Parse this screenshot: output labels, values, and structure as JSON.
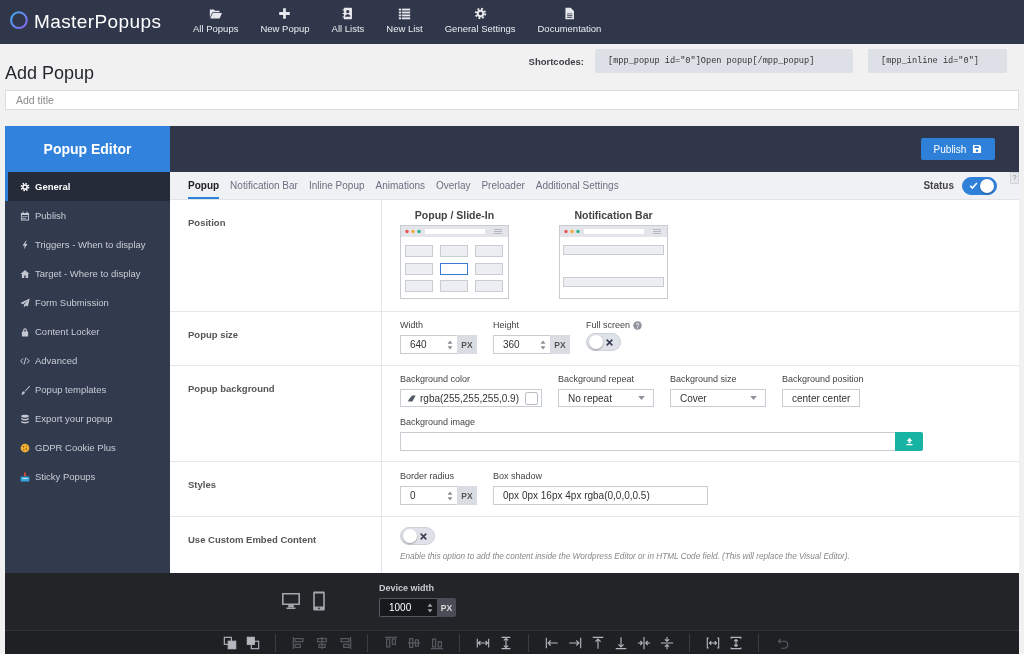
{
  "top_bar": {
    "logo": "MasterPopups",
    "nav": [
      {
        "label": "All Popups"
      },
      {
        "label": "New Popup"
      },
      {
        "label": "All Lists"
      },
      {
        "label": "New List"
      },
      {
        "label": "General Settings"
      },
      {
        "label": "Documentation"
      }
    ]
  },
  "page": {
    "title": "Add Popup",
    "shortcodes": {
      "label": "Shortcodes:",
      "codes": [
        "[mpp_popup id=\"0\"]Open popup[/mpp_popup]",
        "[mpp_inline id=\"0\"]"
      ]
    },
    "title_field": {
      "placeholder": "Add title"
    }
  },
  "editor": {
    "title": "Popup Editor",
    "publish_button": "Publish",
    "sidebar": [
      {
        "label": "General",
        "selected": true
      },
      {
        "label": "Publish",
        "selected": false
      },
      {
        "label": "Triggers - When to display",
        "selected": false
      },
      {
        "label": "Target - Where to display",
        "selected": false
      },
      {
        "label": "Form Submission",
        "selected": false
      },
      {
        "label": "Content Locker",
        "selected": false
      },
      {
        "label": "Advanced",
        "selected": false
      },
      {
        "label": "Popup templates",
        "selected": false
      },
      {
        "label": "Export your popup",
        "selected": false
      },
      {
        "label": "GDPR Cookie Plus",
        "selected": false
      },
      {
        "label": "Sticky Popups",
        "selected": false
      }
    ],
    "tabs": [
      {
        "label": "Popup",
        "selected": true
      },
      {
        "label": "Notification Bar",
        "selected": false
      },
      {
        "label": "Inline Popup",
        "selected": false
      },
      {
        "label": "Animations",
        "selected": false
      },
      {
        "label": "Overlay",
        "selected": false
      },
      {
        "label": "Preloader",
        "selected": false
      },
      {
        "label": "Additional Settings",
        "selected": false
      }
    ],
    "status": {
      "label": "Status",
      "on": true
    },
    "help_tab": "?",
    "sections": [
      {
        "kind": "position",
        "label": "Position",
        "options": [
          {
            "title": "Popup / Slide-In",
            "kind": "grid",
            "cells": [
              {
                "selected": false
              },
              {
                "selected": false
              },
              {
                "selected": false
              },
              {
                "selected": false
              },
              {
                "selected": true
              },
              {
                "selected": false
              },
              {
                "selected": false
              },
              {
                "selected": false
              },
              {
                "selected": false
              }
            ]
          },
          {
            "title": "Notification Bar",
            "kind": "bars",
            "cells": [
              {
                "selected": false
              },
              {
                "selected": false
              }
            ]
          }
        ]
      },
      {
        "kind": "size",
        "label": "Popup size",
        "width": {
          "label": "Width",
          "value": "640",
          "unit": "PX"
        },
        "height": {
          "label": "Height",
          "value": "360",
          "unit": "PX"
        },
        "full_screen": {
          "label": "Full screen",
          "on": false
        }
      },
      {
        "kind": "background",
        "label": "Popup background",
        "color": {
          "label": "Background color",
          "value": "rgba(255,255,255,0.9)"
        },
        "repeat": {
          "label": "Background repeat",
          "value": "No repeat"
        },
        "size": {
          "label": "Background size",
          "value": "Cover"
        },
        "position": {
          "label": "Background position",
          "value": "center center"
        },
        "image": {
          "label": "Background image"
        }
      },
      {
        "kind": "styles",
        "label": "Styles",
        "border_radius": {
          "label": "Border radius",
          "value": "0",
          "unit": "PX"
        },
        "box_shadow": {
          "label": "Box shadow",
          "value": "0px 0px 16px 4px rgba(0,0,0,0.5)"
        }
      },
      {
        "kind": "embed",
        "label": "Use Custom Embed Content",
        "on": false,
        "description": "Enable this option to add the content inside the Wordpress Editor or in HTML Code field. (This will replace the Visual Editor)."
      }
    ]
  },
  "preview_bar": {
    "device_width": {
      "label": "Device width",
      "value": "1000",
      "unit": "PX"
    },
    "toolbar": [
      {
        "tools": [
          {
            "disabled": false
          },
          {
            "disabled": false
          }
        ]
      },
      {
        "tools": [
          {
            "disabled": true
          },
          {
            "disabled": true
          },
          {
            "disabled": true
          }
        ]
      },
      {
        "tools": [
          {
            "disabled": true
          },
          {
            "disabled": true
          },
          {
            "disabled": true
          }
        ]
      },
      {
        "tools": [
          {
            "disabled": false
          },
          {
            "disabled": false
          }
        ]
      },
      {
        "tools": [
          {
            "disabled": false
          },
          {
            "disabled": false
          },
          {
            "disabled": false
          },
          {
            "disabled": false
          },
          {
            "disabled": false
          },
          {
            "disabled": false
          }
        ]
      },
      {
        "tools": [
          {
            "disabled": false
          },
          {
            "disabled": false
          }
        ]
      },
      {
        "tools": [
          {
            "disabled": true
          }
        ]
      }
    ]
  }
}
